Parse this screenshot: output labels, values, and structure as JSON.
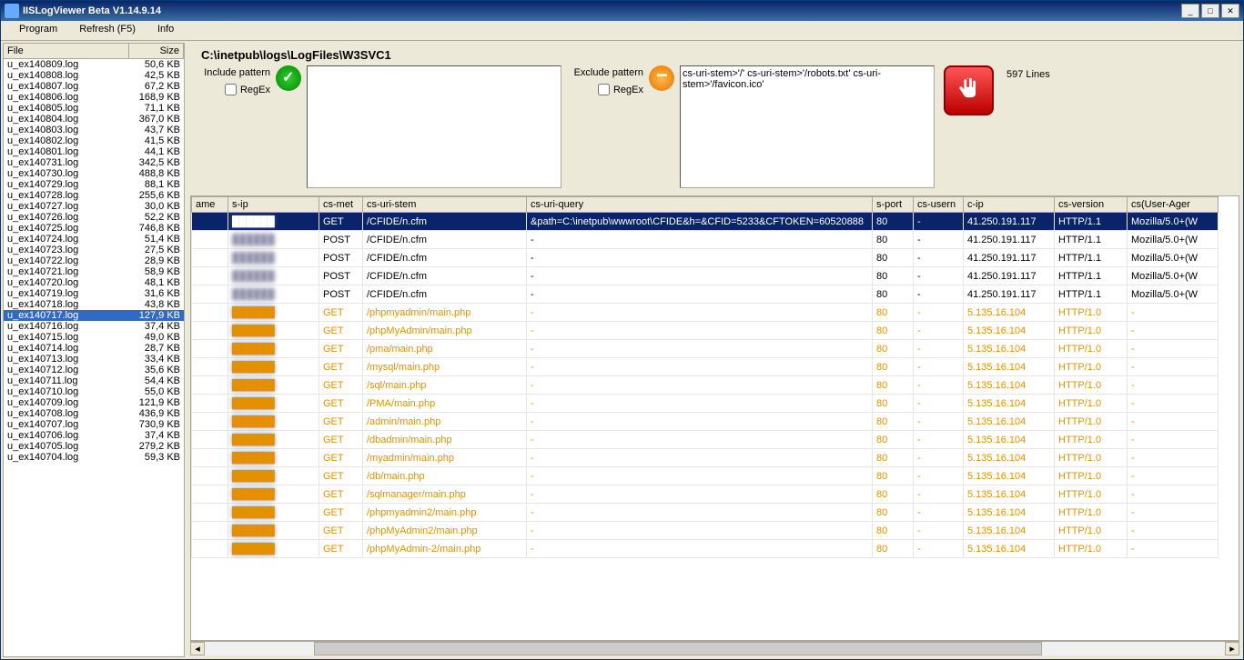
{
  "title": "IISLogViewer Beta V1.14.9.14",
  "menu": [
    "Program",
    "Refresh (F5)",
    "Info"
  ],
  "file_headers": {
    "file": "File",
    "size": "Size"
  },
  "files": [
    {
      "n": "u_ex140809.log",
      "s": "50,6 KB"
    },
    {
      "n": "u_ex140808.log",
      "s": "42,5 KB"
    },
    {
      "n": "u_ex140807.log",
      "s": "67,2 KB"
    },
    {
      "n": "u_ex140806.log",
      "s": "168,9 KB"
    },
    {
      "n": "u_ex140805.log",
      "s": "71,1 KB"
    },
    {
      "n": "u_ex140804.log",
      "s": "367,0 KB"
    },
    {
      "n": "u_ex140803.log",
      "s": "43,7 KB"
    },
    {
      "n": "u_ex140802.log",
      "s": "41,5 KB"
    },
    {
      "n": "u_ex140801.log",
      "s": "44,1 KB"
    },
    {
      "n": "u_ex140731.log",
      "s": "342,5 KB"
    },
    {
      "n": "u_ex140730.log",
      "s": "488,8 KB"
    },
    {
      "n": "u_ex140729.log",
      "s": "88,1 KB"
    },
    {
      "n": "u_ex140728.log",
      "s": "255,6 KB"
    },
    {
      "n": "u_ex140727.log",
      "s": "30,0 KB"
    },
    {
      "n": "u_ex140726.log",
      "s": "52,2 KB"
    },
    {
      "n": "u_ex140725.log",
      "s": "746,8 KB"
    },
    {
      "n": "u_ex140724.log",
      "s": "51,4 KB"
    },
    {
      "n": "u_ex140723.log",
      "s": "27,5 KB"
    },
    {
      "n": "u_ex140722.log",
      "s": "28,9 KB"
    },
    {
      "n": "u_ex140721.log",
      "s": "58,9 KB"
    },
    {
      "n": "u_ex140720.log",
      "s": "48,1 KB"
    },
    {
      "n": "u_ex140719.log",
      "s": "31,6 KB"
    },
    {
      "n": "u_ex140718.log",
      "s": "43,8 KB"
    },
    {
      "n": "u_ex140717.log",
      "s": "127,9 KB",
      "sel": true
    },
    {
      "n": "u_ex140716.log",
      "s": "37,4 KB"
    },
    {
      "n": "u_ex140715.log",
      "s": "49,0 KB"
    },
    {
      "n": "u_ex140714.log",
      "s": "28,7 KB"
    },
    {
      "n": "u_ex140713.log",
      "s": "33,4 KB"
    },
    {
      "n": "u_ex140712.log",
      "s": "35,6 KB"
    },
    {
      "n": "u_ex140711.log",
      "s": "54,4 KB"
    },
    {
      "n": "u_ex140710.log",
      "s": "55,0 KB"
    },
    {
      "n": "u_ex140709.log",
      "s": "121,9 KB"
    },
    {
      "n": "u_ex140708.log",
      "s": "436,9 KB"
    },
    {
      "n": "u_ex140707.log",
      "s": "730,9 KB"
    },
    {
      "n": "u_ex140706.log",
      "s": "37,4 KB"
    },
    {
      "n": "u_ex140705.log",
      "s": "279,2 KB"
    },
    {
      "n": "u_ex140704.log",
      "s": "59,3 KB"
    }
  ],
  "path": "C:\\inetpub\\logs\\LogFiles\\W3SVC1",
  "include_label": "Include pattern",
  "exclude_label": "Exclude pattern",
  "regex_label": "RegEx",
  "exclude_text": "cs-uri-stem>'/'\ncs-uri-stem>'/robots.txt'\ncs-uri-stem>'/favicon.ico'",
  "lines": "597 Lines",
  "cols": [
    "ame",
    "s-ip",
    "cs-met",
    "cs-uri-stem",
    "cs-uri-query",
    "s-port",
    "cs-usern",
    "c-ip",
    "cs-version",
    "cs(User-Ager"
  ],
  "rows": [
    {
      "sel": true,
      "blur": true,
      "m": "GET",
      "stem": "/CFIDE/n.cfm",
      "q": "&path=C:\\inetpub\\wwwroot\\CFIDE&h=&CFID=5233&CFTOKEN=60520888",
      "port": "80",
      "u": "-",
      "cip": "41.250.191.117",
      "v": "HTTP/1.1",
      "ua": "Mozilla/5.0+(W"
    },
    {
      "blur": true,
      "m": "POST",
      "stem": "/CFIDE/n.cfm",
      "q": "-",
      "port": "80",
      "u": "-",
      "cip": "41.250.191.117",
      "v": "HTTP/1.1",
      "ua": "Mozilla/5.0+(W"
    },
    {
      "blur": true,
      "m": "POST",
      "stem": "/CFIDE/n.cfm",
      "q": "-",
      "port": "80",
      "u": "-",
      "cip": "41.250.191.117",
      "v": "HTTP/1.1",
      "ua": "Mozilla/5.0+(W"
    },
    {
      "blur": true,
      "m": "POST",
      "stem": "/CFIDE/n.cfm",
      "q": "-",
      "port": "80",
      "u": "-",
      "cip": "41.250.191.117",
      "v": "HTTP/1.1",
      "ua": "Mozilla/5.0+(W"
    },
    {
      "blur": true,
      "m": "POST",
      "stem": "/CFIDE/n.cfm",
      "q": "-",
      "port": "80",
      "u": "-",
      "cip": "41.250.191.117",
      "v": "HTTP/1.1",
      "ua": "Mozilla/5.0+(W"
    },
    {
      "orange": true,
      "blur": true,
      "m": "GET",
      "stem": "/phpmyadmin/main.php",
      "q": "-",
      "port": "80",
      "u": "-",
      "cip": "5.135.16.104",
      "v": "HTTP/1.0",
      "ua": "-"
    },
    {
      "orange": true,
      "blur": true,
      "m": "GET",
      "stem": "/phpMyAdmin/main.php",
      "q": "-",
      "port": "80",
      "u": "-",
      "cip": "5.135.16.104",
      "v": "HTTP/1.0",
      "ua": "-"
    },
    {
      "orange": true,
      "blur": true,
      "m": "GET",
      "stem": "/pma/main.php",
      "q": "-",
      "port": "80",
      "u": "-",
      "cip": "5.135.16.104",
      "v": "HTTP/1.0",
      "ua": "-"
    },
    {
      "orange": true,
      "blur": true,
      "m": "GET",
      "stem": "/mysql/main.php",
      "q": "-",
      "port": "80",
      "u": "-",
      "cip": "5.135.16.104",
      "v": "HTTP/1.0",
      "ua": "-"
    },
    {
      "orange": true,
      "blur": true,
      "m": "GET",
      "stem": "/sql/main.php",
      "q": "-",
      "port": "80",
      "u": "-",
      "cip": "5.135.16.104",
      "v": "HTTP/1.0",
      "ua": "-"
    },
    {
      "orange": true,
      "blur": true,
      "m": "GET",
      "stem": "/PMA/main.php",
      "q": "-",
      "port": "80",
      "u": "-",
      "cip": "5.135.16.104",
      "v": "HTTP/1.0",
      "ua": "-"
    },
    {
      "orange": true,
      "blur": true,
      "m": "GET",
      "stem": "/admin/main.php",
      "q": "-",
      "port": "80",
      "u": "-",
      "cip": "5.135.16.104",
      "v": "HTTP/1.0",
      "ua": "-"
    },
    {
      "orange": true,
      "blur": true,
      "m": "GET",
      "stem": "/dbadmin/main.php",
      "q": "-",
      "port": "80",
      "u": "-",
      "cip": "5.135.16.104",
      "v": "HTTP/1.0",
      "ua": "-"
    },
    {
      "orange": true,
      "blur": true,
      "m": "GET",
      "stem": "/myadmin/main.php",
      "q": "-",
      "port": "80",
      "u": "-",
      "cip": "5.135.16.104",
      "v": "HTTP/1.0",
      "ua": "-"
    },
    {
      "orange": true,
      "blur": true,
      "m": "GET",
      "stem": "/db/main.php",
      "q": "-",
      "port": "80",
      "u": "-",
      "cip": "5.135.16.104",
      "v": "HTTP/1.0",
      "ua": "-"
    },
    {
      "orange": true,
      "blur": true,
      "m": "GET",
      "stem": "/sqlmanager/main.php",
      "q": "-",
      "port": "80",
      "u": "-",
      "cip": "5.135.16.104",
      "v": "HTTP/1.0",
      "ua": "-"
    },
    {
      "orange": true,
      "blur": true,
      "m": "GET",
      "stem": "/phpmyadmin2/main.php",
      "q": "-",
      "port": "80",
      "u": "-",
      "cip": "5.135.16.104",
      "v": "HTTP/1.0",
      "ua": "-"
    },
    {
      "orange": true,
      "blur": true,
      "m": "GET",
      "stem": "/phpMyAdmin2/main.php",
      "q": "-",
      "port": "80",
      "u": "-",
      "cip": "5.135.16.104",
      "v": "HTTP/1.0",
      "ua": "-"
    },
    {
      "orange": true,
      "blur": true,
      "m": "GET",
      "stem": "/phpMyAdmin-2/main.php",
      "q": "-",
      "port": "80",
      "u": "-",
      "cip": "5.135.16.104",
      "v": "HTTP/1.0",
      "ua": "-"
    }
  ]
}
